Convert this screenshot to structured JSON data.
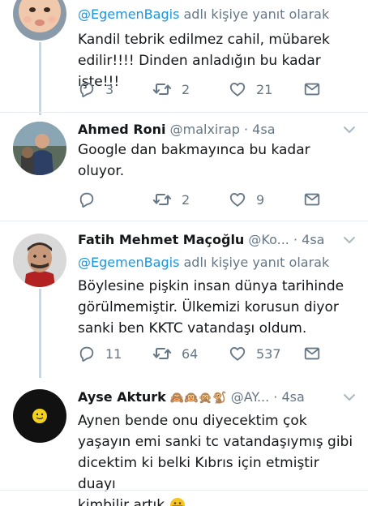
{
  "tweets": [
    {
      "reply_prefix": "@EgemenBagis",
      "reply_suffix": " adlı kişiye yanıt olarak",
      "text_lines": [
        "Kandil tebrik edilmez cahil, mübarek",
        "edilir!!!! Dinden anladığın bu kadar işte!!!"
      ],
      "replies": "3",
      "retweets": "2",
      "likes": "21"
    },
    {
      "name": "Ahmed Roni",
      "handle": "@malxirap",
      "time": "· 4sa",
      "text_lines": [
        "Google dan bakmayınca bu kadar oluyor."
      ],
      "replies": "",
      "retweets": "2",
      "likes": "9"
    },
    {
      "name": "Fatih Mehmet Maçoğlu",
      "handle": "@Ko...",
      "time": "· 4sa",
      "reply_prefix": "@EgemenBagis",
      "reply_suffix": " adlı kişiye yanıt olarak",
      "text_lines": [
        "Böylesine pişkin insan dünya tarihinde",
        "görülmemiştir. Ülkemizi korusun diyor",
        "sanki ben KKTC vatandaşı oldum."
      ],
      "replies": "11",
      "retweets": "64",
      "likes": "537"
    },
    {
      "name": "Ayse Akturk",
      "name_emojis": "🙈🙉🙊🐒",
      "handle": "@AY...",
      "time": "· 4sa",
      "text_lines": [
        "Aynen bende onu diyecektim çok",
        "yaşayın emi sanki tc vatandaşıymış gibi",
        "dicektim ki belki Kıbrıs için etmiştir duayı",
        "kimbilir artık"
      ]
    }
  ],
  "icons": {
    "reply": "reply-icon",
    "retweet": "retweet-icon",
    "like": "heart-icon",
    "dm": "envelope-icon",
    "caret": "chevron-down-icon"
  },
  "colors": {
    "mention": "#1b95e0",
    "secondary_text": "#657786",
    "divider": "#e6ecf0"
  }
}
